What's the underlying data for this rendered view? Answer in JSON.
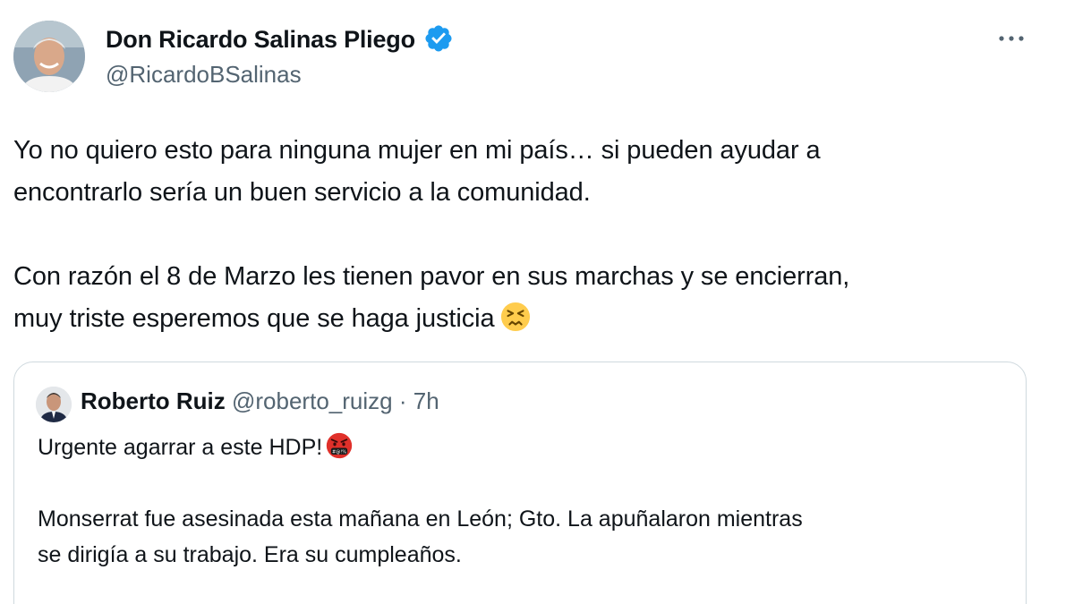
{
  "tweet": {
    "author": {
      "name": "Don Ricardo Salinas Pliego",
      "handle": "@RicardoBSalinas",
      "verified": true
    },
    "text": {
      "line1": "Yo no quiero esto para ninguna mujer en mi país… si pueden ayudar a",
      "line2": "encontrarlo sería un buen servicio a la comunidad.",
      "line3": "Con razón el 8 de Marzo les tienen pavor en sus marchas y se encierran,",
      "line4": "muy triste esperemos que se haga justicia",
      "emoji": "persevering-face"
    }
  },
  "quote": {
    "author": {
      "name": "Roberto Ruiz",
      "handle": "@roberto_ruizg",
      "separator": "·",
      "time": "7h"
    },
    "text": {
      "line1": "Urgente agarrar a este HDP!",
      "emoji": "face-with-symbols-on-mouth",
      "line2": "Monserrat fue asesinada esta mañana en León; Gto. La apuñalaron mientras",
      "line3": "se dirigía a su trabajo. Era su cumpleaños."
    }
  },
  "colors": {
    "text": "#0f1419",
    "secondary": "#536471",
    "verified_blue": "#1d9bf0",
    "border": "#cfd9de",
    "angry_red": "#e0302a",
    "emoji_yellow": "#ffcc4d"
  }
}
